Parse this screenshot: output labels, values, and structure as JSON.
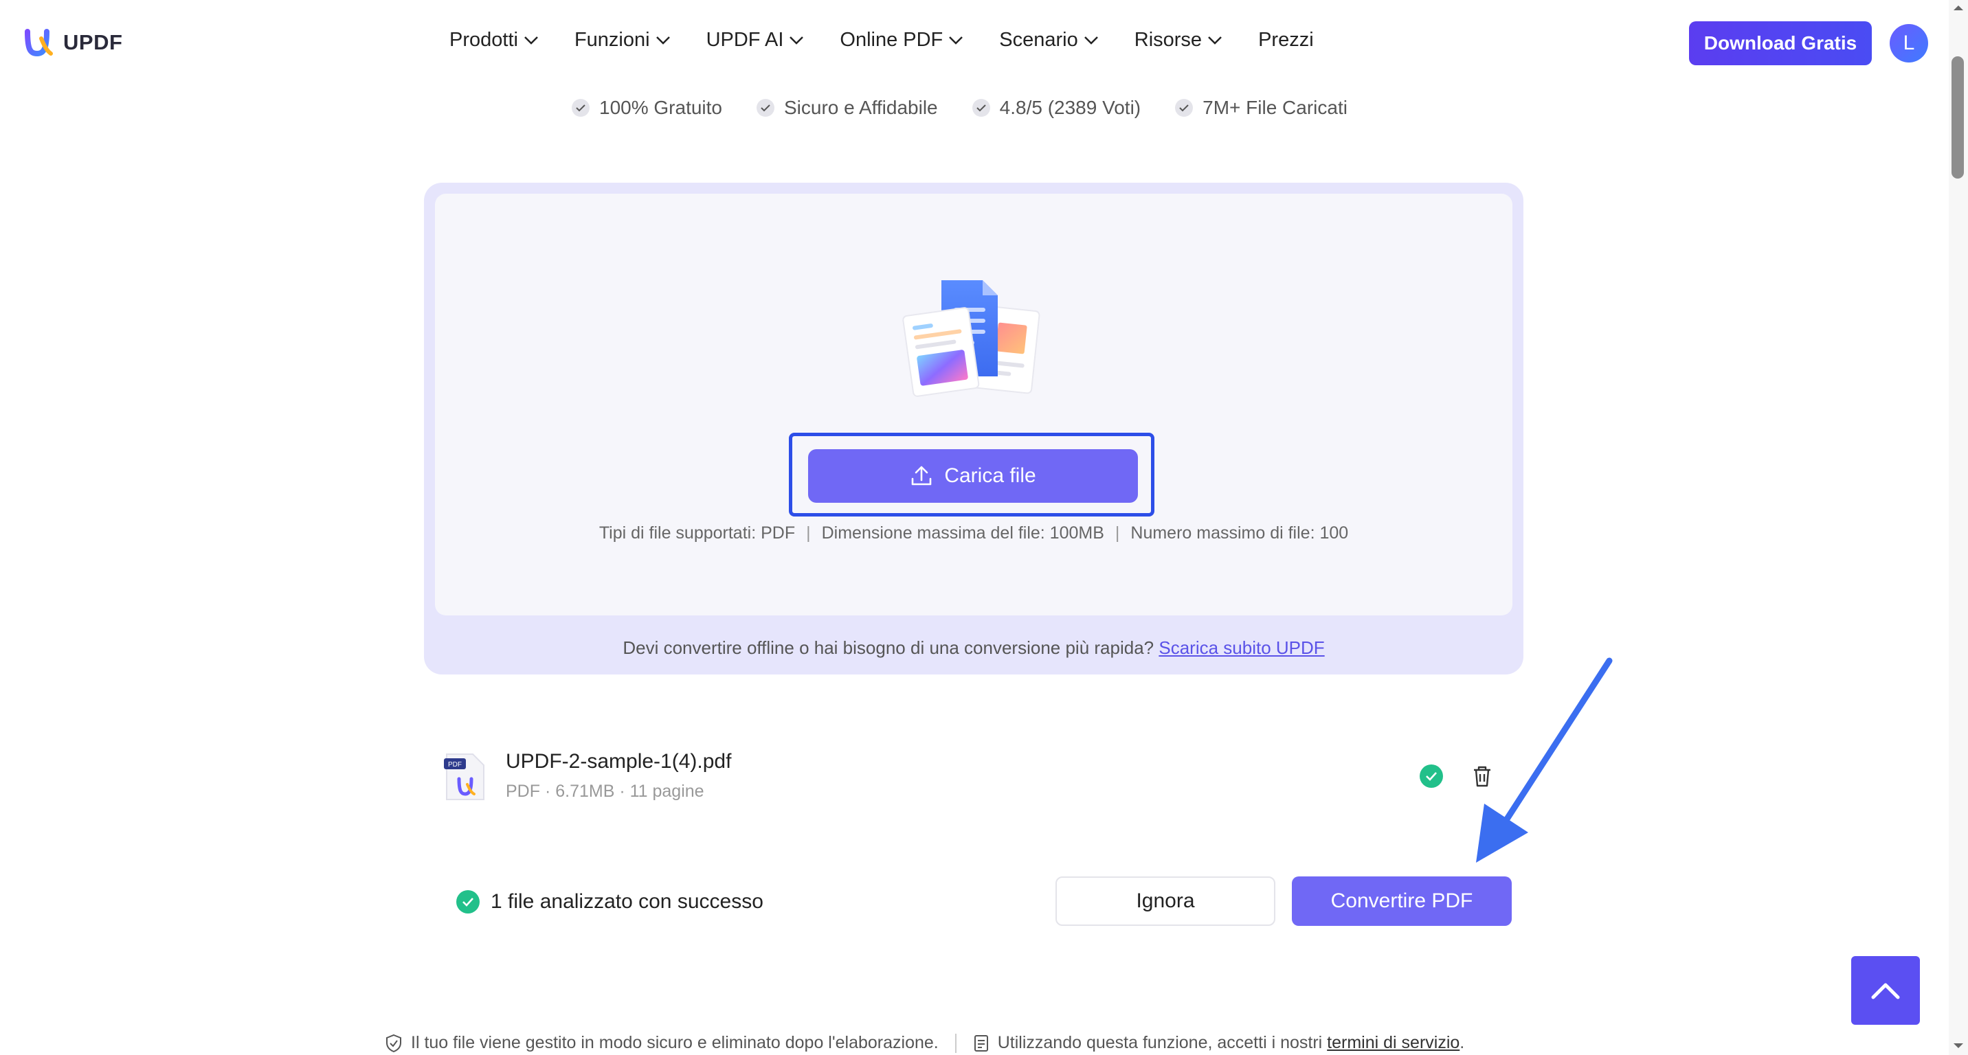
{
  "header": {
    "logo_text": "UPDF",
    "nav": [
      {
        "label": "Prodotti",
        "has_dropdown": true
      },
      {
        "label": "Funzioni",
        "has_dropdown": true
      },
      {
        "label": "UPDF AI",
        "has_dropdown": true
      },
      {
        "label": "Online PDF",
        "has_dropdown": true
      },
      {
        "label": "Scenario",
        "has_dropdown": true
      },
      {
        "label": "Risorse",
        "has_dropdown": true
      },
      {
        "label": "Prezzi",
        "has_dropdown": false
      }
    ],
    "download_label": "Download Gratis",
    "avatar_initial": "L"
  },
  "badges": [
    "100% Gratuito",
    "Sicuro e Affidabile",
    "4.8/5 (2389 Voti)",
    "7M+ File Caricati"
  ],
  "upload": {
    "button_label": "Carica file",
    "file_types": "Tipi di file supportati: PDF",
    "max_size": "Dimensione massima del file: 100MB",
    "max_files": "Numero massimo di file: 100",
    "offline_text": "Devi convertire offline o hai bisogno di una conversione più rapida?",
    "offline_link": "Scarica subito UPDF"
  },
  "file": {
    "name": "UPDF-2-sample-1(4).pdf",
    "meta": "PDF · 6.71MB · 11 pagine",
    "icon_badge": "PDF"
  },
  "actions": {
    "success_text": "1 file analizzato con successo",
    "ignore_label": "Ignora",
    "convert_label": "Convertire PDF"
  },
  "footer": {
    "secure_text": "Il tuo file viene gestito in modo sicuro e eliminato dopo l'elaborazione.",
    "terms_text": "Utilizzando questa funzione, accetti i nostri",
    "terms_link": "termini di servizio",
    "terms_end": "."
  },
  "colors": {
    "accent": "#7068f5",
    "brand": "#5b3df0",
    "success": "#22c08a",
    "annotation_arrow": "#3b6ef0"
  }
}
